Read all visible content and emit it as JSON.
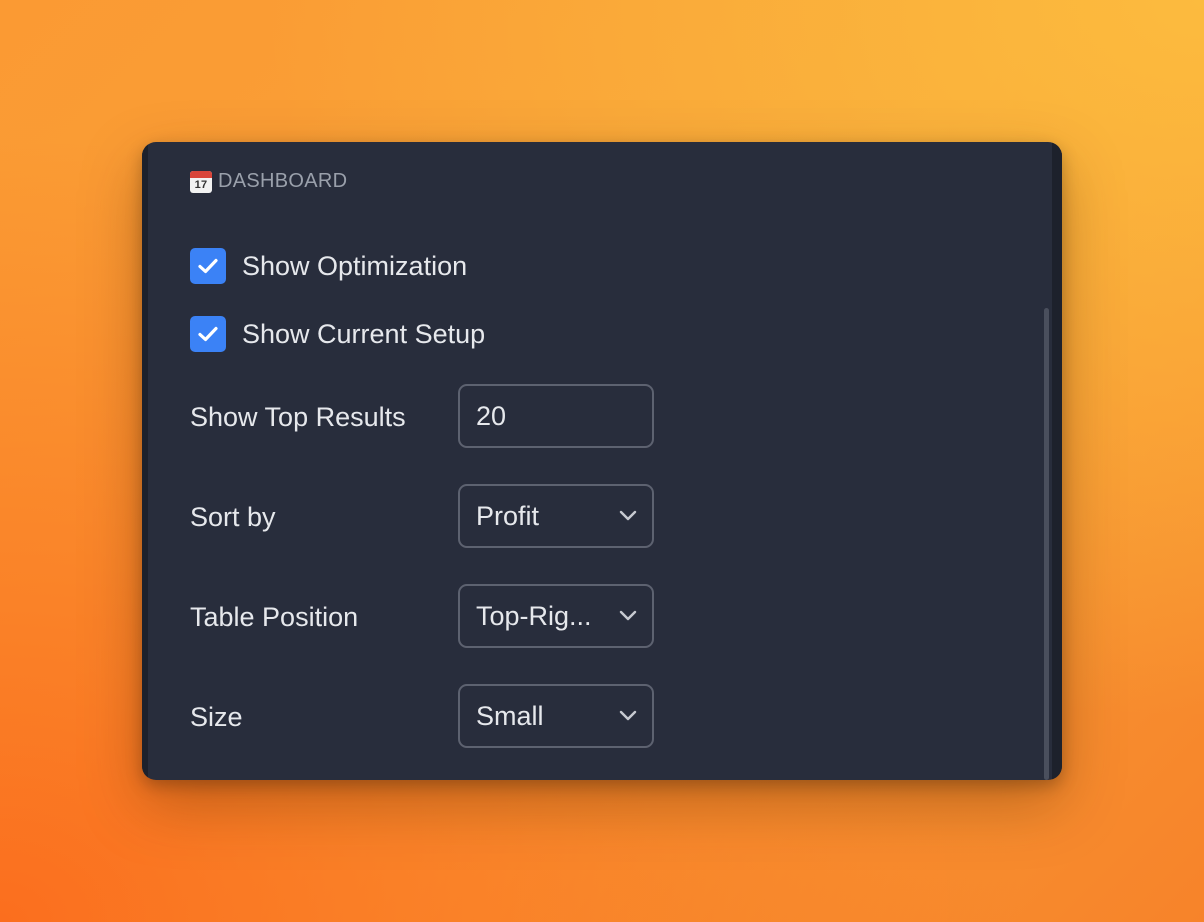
{
  "header": {
    "icon": "calendar-icon",
    "icon_day": "17",
    "title": "DASHBOARD"
  },
  "checkboxes": [
    {
      "label": "Show Optimization",
      "checked": true
    },
    {
      "label": "Show Current Setup",
      "checked": true
    }
  ],
  "fields": {
    "top_results": {
      "label": "Show Top Results",
      "value": "20"
    },
    "sort_by": {
      "label": "Sort by",
      "value": "Profit"
    },
    "table_position": {
      "label": "Table Position",
      "value": "Top-Rig..."
    },
    "size": {
      "label": "Size",
      "value": "Small"
    }
  },
  "colors": {
    "accent": "#3b82f6",
    "panel_bg": "#282d3c",
    "text": "#e6e8ec",
    "muted_text": "#9aa0ab",
    "border": "#5d6270"
  }
}
